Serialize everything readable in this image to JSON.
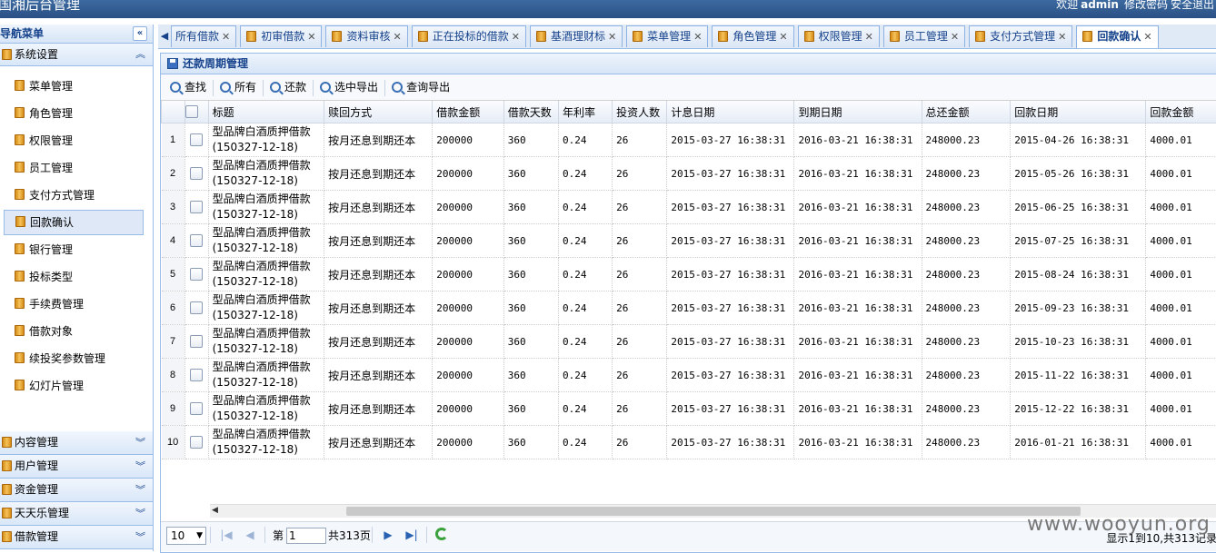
{
  "app": {
    "title": "国湘后台管理",
    "welcome": "欢迎",
    "user": "admin",
    "change_password": "修改密码",
    "logout": "安全退出"
  },
  "nav": {
    "header": "导航菜单",
    "active_section": "系统设置",
    "items": [
      {
        "label": "菜单管理"
      },
      {
        "label": "角色管理"
      },
      {
        "label": "权限管理"
      },
      {
        "label": "员工管理"
      },
      {
        "label": "支付方式管理"
      },
      {
        "label": "回款确认",
        "active": true
      },
      {
        "label": "银行管理"
      },
      {
        "label": "投标类型"
      },
      {
        "label": "手续费管理"
      },
      {
        "label": "借款对象"
      },
      {
        "label": "续投奖参数管理"
      },
      {
        "label": "幻灯片管理"
      }
    ],
    "sections": [
      {
        "label": "内容管理"
      },
      {
        "label": "用户管理"
      },
      {
        "label": "资金管理"
      },
      {
        "label": "天天乐管理"
      },
      {
        "label": "借款管理"
      }
    ]
  },
  "tabs": [
    {
      "label": "所有借款"
    },
    {
      "label": "初审借款"
    },
    {
      "label": "资料审核"
    },
    {
      "label": "正在投标的借款"
    },
    {
      "label": "基酒理财标"
    },
    {
      "label": "菜单管理"
    },
    {
      "label": "角色管理"
    },
    {
      "label": "权限管理"
    },
    {
      "label": "员工管理"
    },
    {
      "label": "支付方式管理"
    },
    {
      "label": "回款确认",
      "active": true
    }
  ],
  "panel": {
    "title": "还款周期管理",
    "toolbar": {
      "find": "查找",
      "all": "所有",
      "repay": "还款",
      "export_selected": "选中导出",
      "export_query": "查询导出"
    }
  },
  "table": {
    "columns": [
      "标题",
      "赎回方式",
      "借款金额",
      "借款天数",
      "年利率",
      "投资人数",
      "计息日期",
      "到期日期",
      "总还金额",
      "回款日期",
      "回款金额"
    ],
    "rows": [
      {
        "num": "1",
        "title1": "型品牌白酒质押借款",
        "title2": "(150327-12-18)",
        "method": "按月还息到期还本",
        "amount": "200000",
        "days": "360",
        "rate": "0.24",
        "investors": "26",
        "start": "2015-03-27 16:38:31",
        "due": "2016-03-21 16:38:31",
        "total": "248000.23",
        "repay_date": "2015-04-26 16:38:31",
        "repay_amount": "4000.01"
      },
      {
        "num": "2",
        "title1": "型品牌白酒质押借款",
        "title2": "(150327-12-18)",
        "method": "按月还息到期还本",
        "amount": "200000",
        "days": "360",
        "rate": "0.24",
        "investors": "26",
        "start": "2015-03-27 16:38:31",
        "due": "2016-03-21 16:38:31",
        "total": "248000.23",
        "repay_date": "2015-05-26 16:38:31",
        "repay_amount": "4000.01"
      },
      {
        "num": "3",
        "title1": "型品牌白酒质押借款",
        "title2": "(150327-12-18)",
        "method": "按月还息到期还本",
        "amount": "200000",
        "days": "360",
        "rate": "0.24",
        "investors": "26",
        "start": "2015-03-27 16:38:31",
        "due": "2016-03-21 16:38:31",
        "total": "248000.23",
        "repay_date": "2015-06-25 16:38:31",
        "repay_amount": "4000.01"
      },
      {
        "num": "4",
        "title1": "型品牌白酒质押借款",
        "title2": "(150327-12-18)",
        "method": "按月还息到期还本",
        "amount": "200000",
        "days": "360",
        "rate": "0.24",
        "investors": "26",
        "start": "2015-03-27 16:38:31",
        "due": "2016-03-21 16:38:31",
        "total": "248000.23",
        "repay_date": "2015-07-25 16:38:31",
        "repay_amount": "4000.01"
      },
      {
        "num": "5",
        "title1": "型品牌白酒质押借款",
        "title2": "(150327-12-18)",
        "method": "按月还息到期还本",
        "amount": "200000",
        "days": "360",
        "rate": "0.24",
        "investors": "26",
        "start": "2015-03-27 16:38:31",
        "due": "2016-03-21 16:38:31",
        "total": "248000.23",
        "repay_date": "2015-08-24 16:38:31",
        "repay_amount": "4000.01"
      },
      {
        "num": "6",
        "title1": "型品牌白酒质押借款",
        "title2": "(150327-12-18)",
        "method": "按月还息到期还本",
        "amount": "200000",
        "days": "360",
        "rate": "0.24",
        "investors": "26",
        "start": "2015-03-27 16:38:31",
        "due": "2016-03-21 16:38:31",
        "total": "248000.23",
        "repay_date": "2015-09-23 16:38:31",
        "repay_amount": "4000.01"
      },
      {
        "num": "7",
        "title1": "型品牌白酒质押借款",
        "title2": "(150327-12-18)",
        "method": "按月还息到期还本",
        "amount": "200000",
        "days": "360",
        "rate": "0.24",
        "investors": "26",
        "start": "2015-03-27 16:38:31",
        "due": "2016-03-21 16:38:31",
        "total": "248000.23",
        "repay_date": "2015-10-23 16:38:31",
        "repay_amount": "4000.01"
      },
      {
        "num": "8",
        "title1": "型品牌白酒质押借款",
        "title2": "(150327-12-18)",
        "method": "按月还息到期还本",
        "amount": "200000",
        "days": "360",
        "rate": "0.24",
        "investors": "26",
        "start": "2015-03-27 16:38:31",
        "due": "2016-03-21 16:38:31",
        "total": "248000.23",
        "repay_date": "2015-11-22 16:38:31",
        "repay_amount": "4000.01"
      },
      {
        "num": "9",
        "title1": "型品牌白酒质押借款",
        "title2": "(150327-12-18)",
        "method": "按月还息到期还本",
        "amount": "200000",
        "days": "360",
        "rate": "0.24",
        "investors": "26",
        "start": "2015-03-27 16:38:31",
        "due": "2016-03-21 16:38:31",
        "total": "248000.23",
        "repay_date": "2015-12-22 16:38:31",
        "repay_amount": "4000.01"
      },
      {
        "num": "10",
        "title1": "型品牌白酒质押借款",
        "title2": "(150327-12-18)",
        "method": "按月还息到期还本",
        "amount": "200000",
        "days": "360",
        "rate": "0.24",
        "investors": "26",
        "start": "2015-03-27 16:38:31",
        "due": "2016-03-21 16:38:31",
        "total": "248000.23",
        "repay_date": "2016-01-21 16:38:31",
        "repay_amount": "4000.01"
      }
    ]
  },
  "pager": {
    "page_size": "10",
    "page_prefix": "第",
    "page_value": "1",
    "total_pages": "共313页",
    "info": "显示1到10,共313记录"
  },
  "watermark": "www.wooyun.org"
}
